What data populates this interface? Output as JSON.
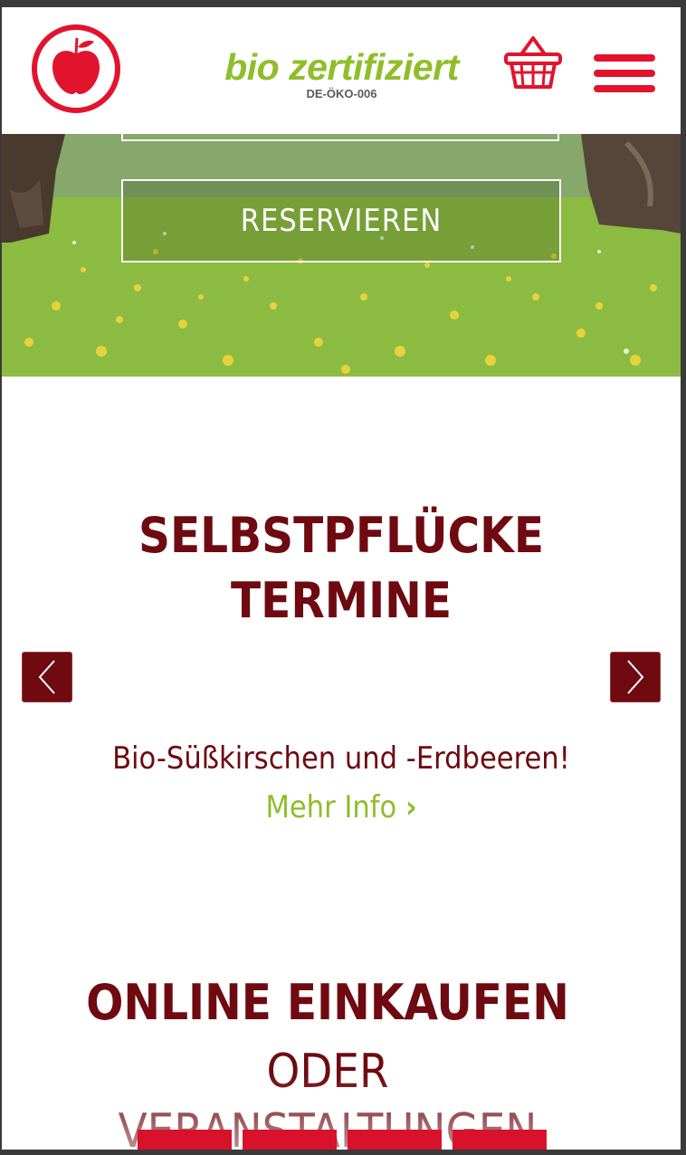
{
  "header": {
    "certificate_title": "bio zertifiziert",
    "certificate_code": "DE-ÖKO-006"
  },
  "hero": {
    "reserve_label": "RESERVIEREN"
  },
  "termine": {
    "title_line1": "SELBSTPFLÜCKE",
    "title_line2": "TERMINE",
    "slide_text": "Bio-Süßkirschen und -Erdbeeren!",
    "more_label": "Mehr Info",
    "more_chevron": "›"
  },
  "shop": {
    "title": "ONLINE EINKAUFEN",
    "oder": "ODER",
    "events_fragment": "VERANSTALTUNGEN"
  },
  "colors": {
    "brand_red": "#e2142d",
    "dark_red": "#6e0a10",
    "green": "#8fbe2a"
  }
}
